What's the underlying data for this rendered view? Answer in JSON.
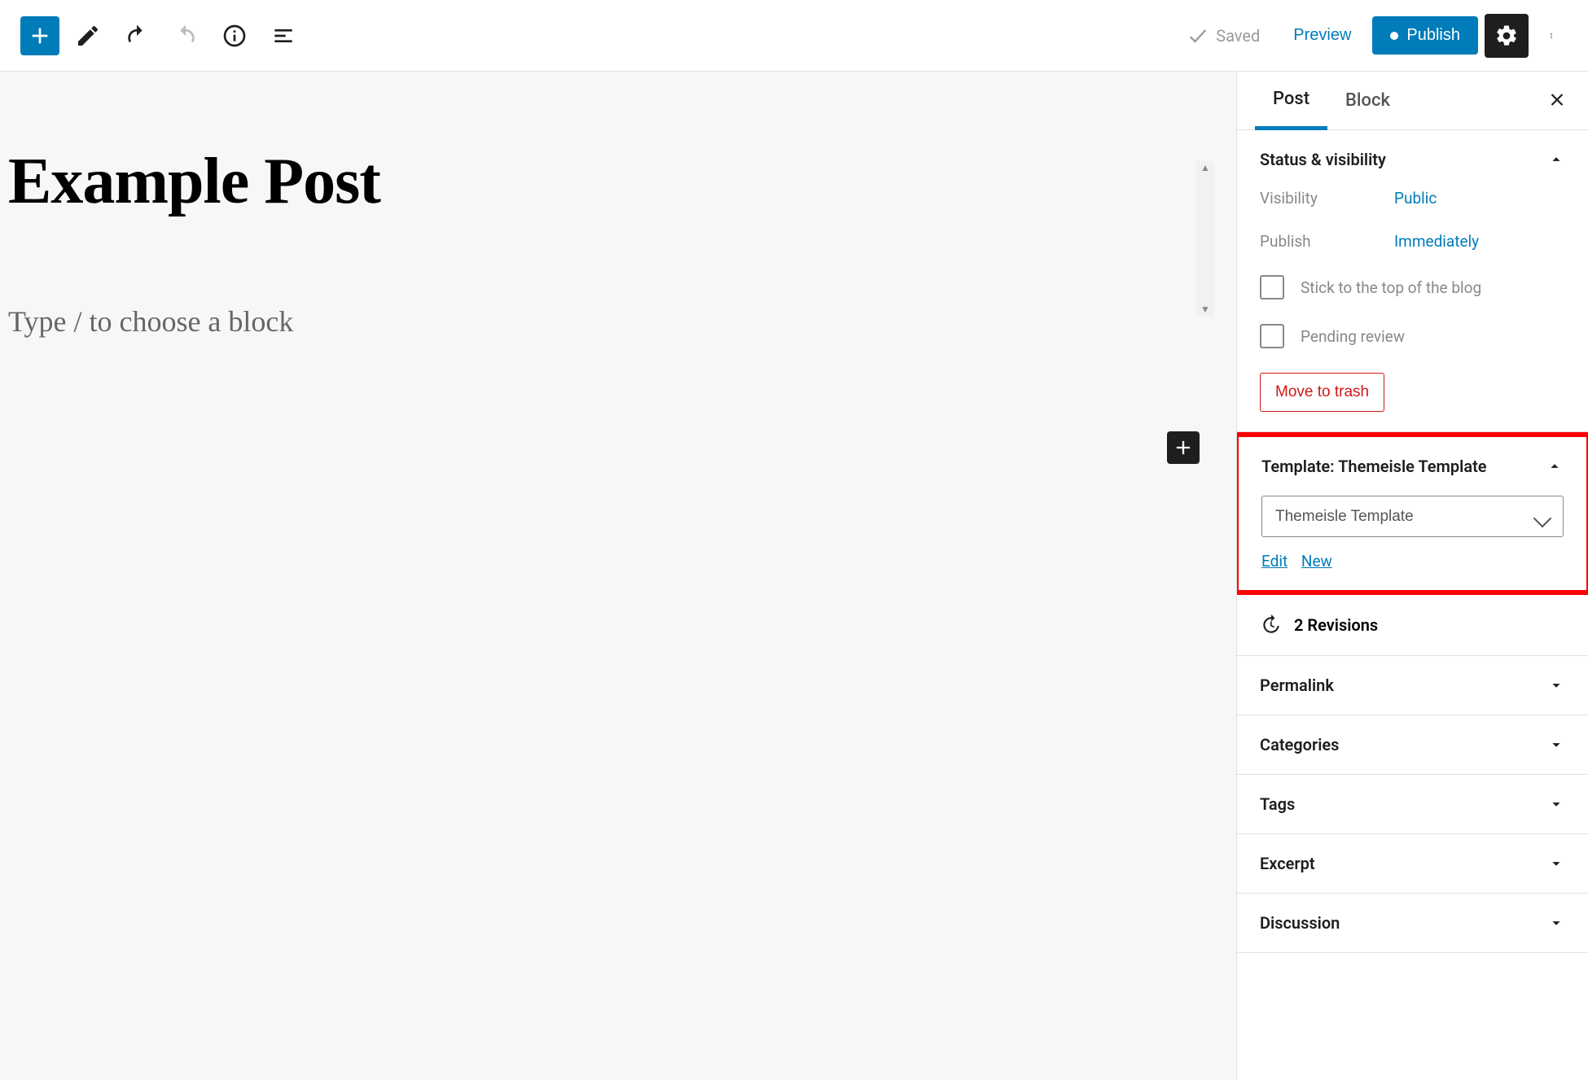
{
  "toolbar": {
    "saved_label": "Saved",
    "preview_label": "Preview",
    "publish_label": "Publish"
  },
  "editor": {
    "post_title": "Example Post",
    "block_placeholder": "Type / to choose a block"
  },
  "sidebar": {
    "tabs": {
      "post": "Post",
      "block": "Block"
    },
    "status_panel": {
      "title": "Status & visibility",
      "visibility_label": "Visibility",
      "visibility_value": "Public",
      "publish_label": "Publish",
      "publish_value": "Immediately",
      "stick_label": "Stick to the top of the blog",
      "pending_label": "Pending review",
      "trash_label": "Move to trash"
    },
    "template_panel": {
      "title": "Template: Themeisle Template",
      "selected": "Themeisle Template",
      "edit_label": "Edit",
      "new_label": "New"
    },
    "revisions": {
      "label": "2 Revisions"
    },
    "collapsed_panels": {
      "permalink": "Permalink",
      "categories": "Categories",
      "tags": "Tags",
      "excerpt": "Excerpt",
      "discussion": "Discussion"
    }
  }
}
